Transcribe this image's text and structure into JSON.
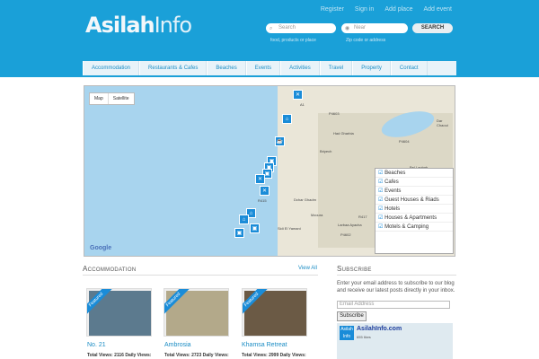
{
  "header": {
    "logo_bold": "Asilah",
    "logo_light": "Info",
    "links": [
      "Register",
      "Sign in",
      "Add place",
      "Add event"
    ],
    "search_placeholder": "Search",
    "near_placeholder": "Near",
    "search_button": "SEARCH",
    "search_hint": "food, products or place",
    "near_hint": "Zip code or address"
  },
  "nav": [
    "Accommodation",
    "Restaurants & Cafes",
    "Beaches",
    "Events",
    "Activities",
    "Travel",
    "Property",
    "Contact"
  ],
  "map": {
    "map_button": "Map",
    "satellite_button": "Satellite",
    "places": [
      "Briyech",
      "Had Gharbia",
      "Dchar Ghadm",
      "Mzoura",
      "Larbaa Ayacha",
      "Sidi El Yamani",
      "Dar Chaoui",
      "Bel Laghab"
    ],
    "roads": [
      "A1",
      "N1",
      "P4603",
      "P4604",
      "R415",
      "R417",
      "P4602"
    ],
    "legend": [
      "Beaches",
      "Cafes",
      "Events",
      "Guest Houses & Riads",
      "Hotels",
      "Houses & Apartments",
      "Motels & Camping"
    ],
    "google_logo": "Google"
  },
  "accommodation": {
    "title": "Accommodation",
    "view_all": "View All",
    "ribbon": "Featured",
    "cards": [
      {
        "name": "No. 21",
        "views": "Total Views: 2116  Daily Views:"
      },
      {
        "name": "Ambrosia",
        "views": "Total Views: 2723  Daily Views:"
      },
      {
        "name": "Khamsa Retreat",
        "views": "Total Views: 2999  Daily Views:"
      }
    ]
  },
  "subscribe": {
    "title": "Subscribe",
    "text": "Enter your email address to subscribe to our blog and receive our latest posts directly in your inbox.",
    "email_placeholder": "Email Address",
    "button": "Subscribe",
    "fb_box": "Asilah Info",
    "fb_name": "AsilahInfo.com",
    "fb_likes": "655 likes"
  }
}
